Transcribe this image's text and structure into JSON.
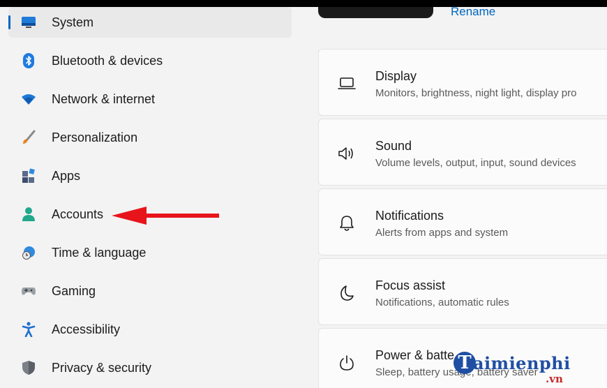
{
  "sidebar": {
    "items": [
      {
        "label": "System",
        "icon": "monitor-icon",
        "active": true
      },
      {
        "label": "Bluetooth & devices",
        "icon": "bluetooth-icon"
      },
      {
        "label": "Network & internet",
        "icon": "wifi-icon"
      },
      {
        "label": "Personalization",
        "icon": "brush-icon"
      },
      {
        "label": "Apps",
        "icon": "apps-icon"
      },
      {
        "label": "Accounts",
        "icon": "person-icon"
      },
      {
        "label": "Time & language",
        "icon": "globe-clock-icon"
      },
      {
        "label": "Gaming",
        "icon": "gamepad-icon"
      },
      {
        "label": "Accessibility",
        "icon": "accessibility-icon"
      },
      {
        "label": "Privacy & security",
        "icon": "shield-icon"
      }
    ]
  },
  "header": {
    "rename_label": "Rename"
  },
  "cards": [
    {
      "title": "Display",
      "subtitle": "Monitors, brightness, night light, display pro",
      "icon": "laptop-icon"
    },
    {
      "title": "Sound",
      "subtitle": "Volume levels, output, input, sound devices",
      "icon": "speaker-icon"
    },
    {
      "title": "Notifications",
      "subtitle": "Alerts from apps and system",
      "icon": "bell-icon"
    },
    {
      "title": "Focus assist",
      "subtitle": "Notifications, automatic rules",
      "icon": "moon-icon"
    },
    {
      "title": "Power & batte",
      "subtitle": "Sleep, battery usage, battery saver",
      "icon": "power-icon"
    }
  ],
  "watermark": {
    "initial": "T",
    "main": "aimienphi",
    "suffix": ".vn"
  },
  "colors": {
    "accent": "#0067c0",
    "annotation_arrow": "#e8141b",
    "background": "#f3f3f3"
  }
}
